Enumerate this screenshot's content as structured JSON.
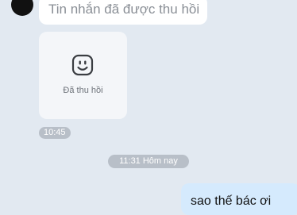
{
  "messages": {
    "recalled_text": "Tin nhắn đã được thu hồi",
    "recalled_sticker_label": "Đã thu hồi",
    "recalled_time": "10:45",
    "date_separator": "11:31 Hôm nay",
    "outgoing_text": "sao thế bác ơi"
  },
  "icons": {
    "sticker": "smiley-face-icon",
    "avatar": "avatar"
  },
  "colors": {
    "background": "#e2e9f1",
    "incoming_bubble": "#ffffff",
    "sticker_bubble": "#f4f6f9",
    "outgoing_bubble": "#d5eafd",
    "pill": "#b8bfc8",
    "recalled_text": "#8a8f96"
  }
}
